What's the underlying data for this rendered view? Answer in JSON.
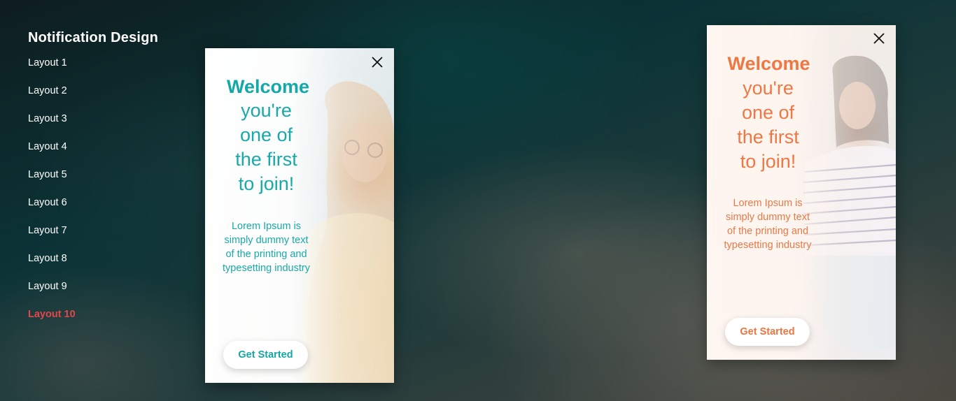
{
  "sidebar": {
    "title": "Notification Design",
    "items": [
      {
        "label": "Layout 1"
      },
      {
        "label": "Layout 2"
      },
      {
        "label": "Layout 3"
      },
      {
        "label": "Layout 4"
      },
      {
        "label": "Layout 5"
      },
      {
        "label": "Layout 6"
      },
      {
        "label": "Layout 7"
      },
      {
        "label": "Layout 8"
      },
      {
        "label": "Layout 9"
      },
      {
        "label": "Layout 10",
        "active": true
      }
    ]
  },
  "cards": [
    {
      "theme_color": "#17a7a8",
      "heading": "Welcome",
      "subheading_lines": [
        "you're",
        "one of",
        "the first",
        "to join!"
      ],
      "description": "Lorem Ipsum is simply dummy text of the printing and typesetting industry",
      "cta_label": "Get Started",
      "close_icon": "close-icon"
    },
    {
      "theme_color": "#ef7744",
      "heading": "Welcome",
      "subheading_lines": [
        "you're",
        "one of",
        "the first",
        "to join!"
      ],
      "description": "Lorem Ipsum is simply dummy text of the printing and typesetting industry",
      "cta_label": "Get Started",
      "close_icon": "close-icon"
    }
  ]
}
